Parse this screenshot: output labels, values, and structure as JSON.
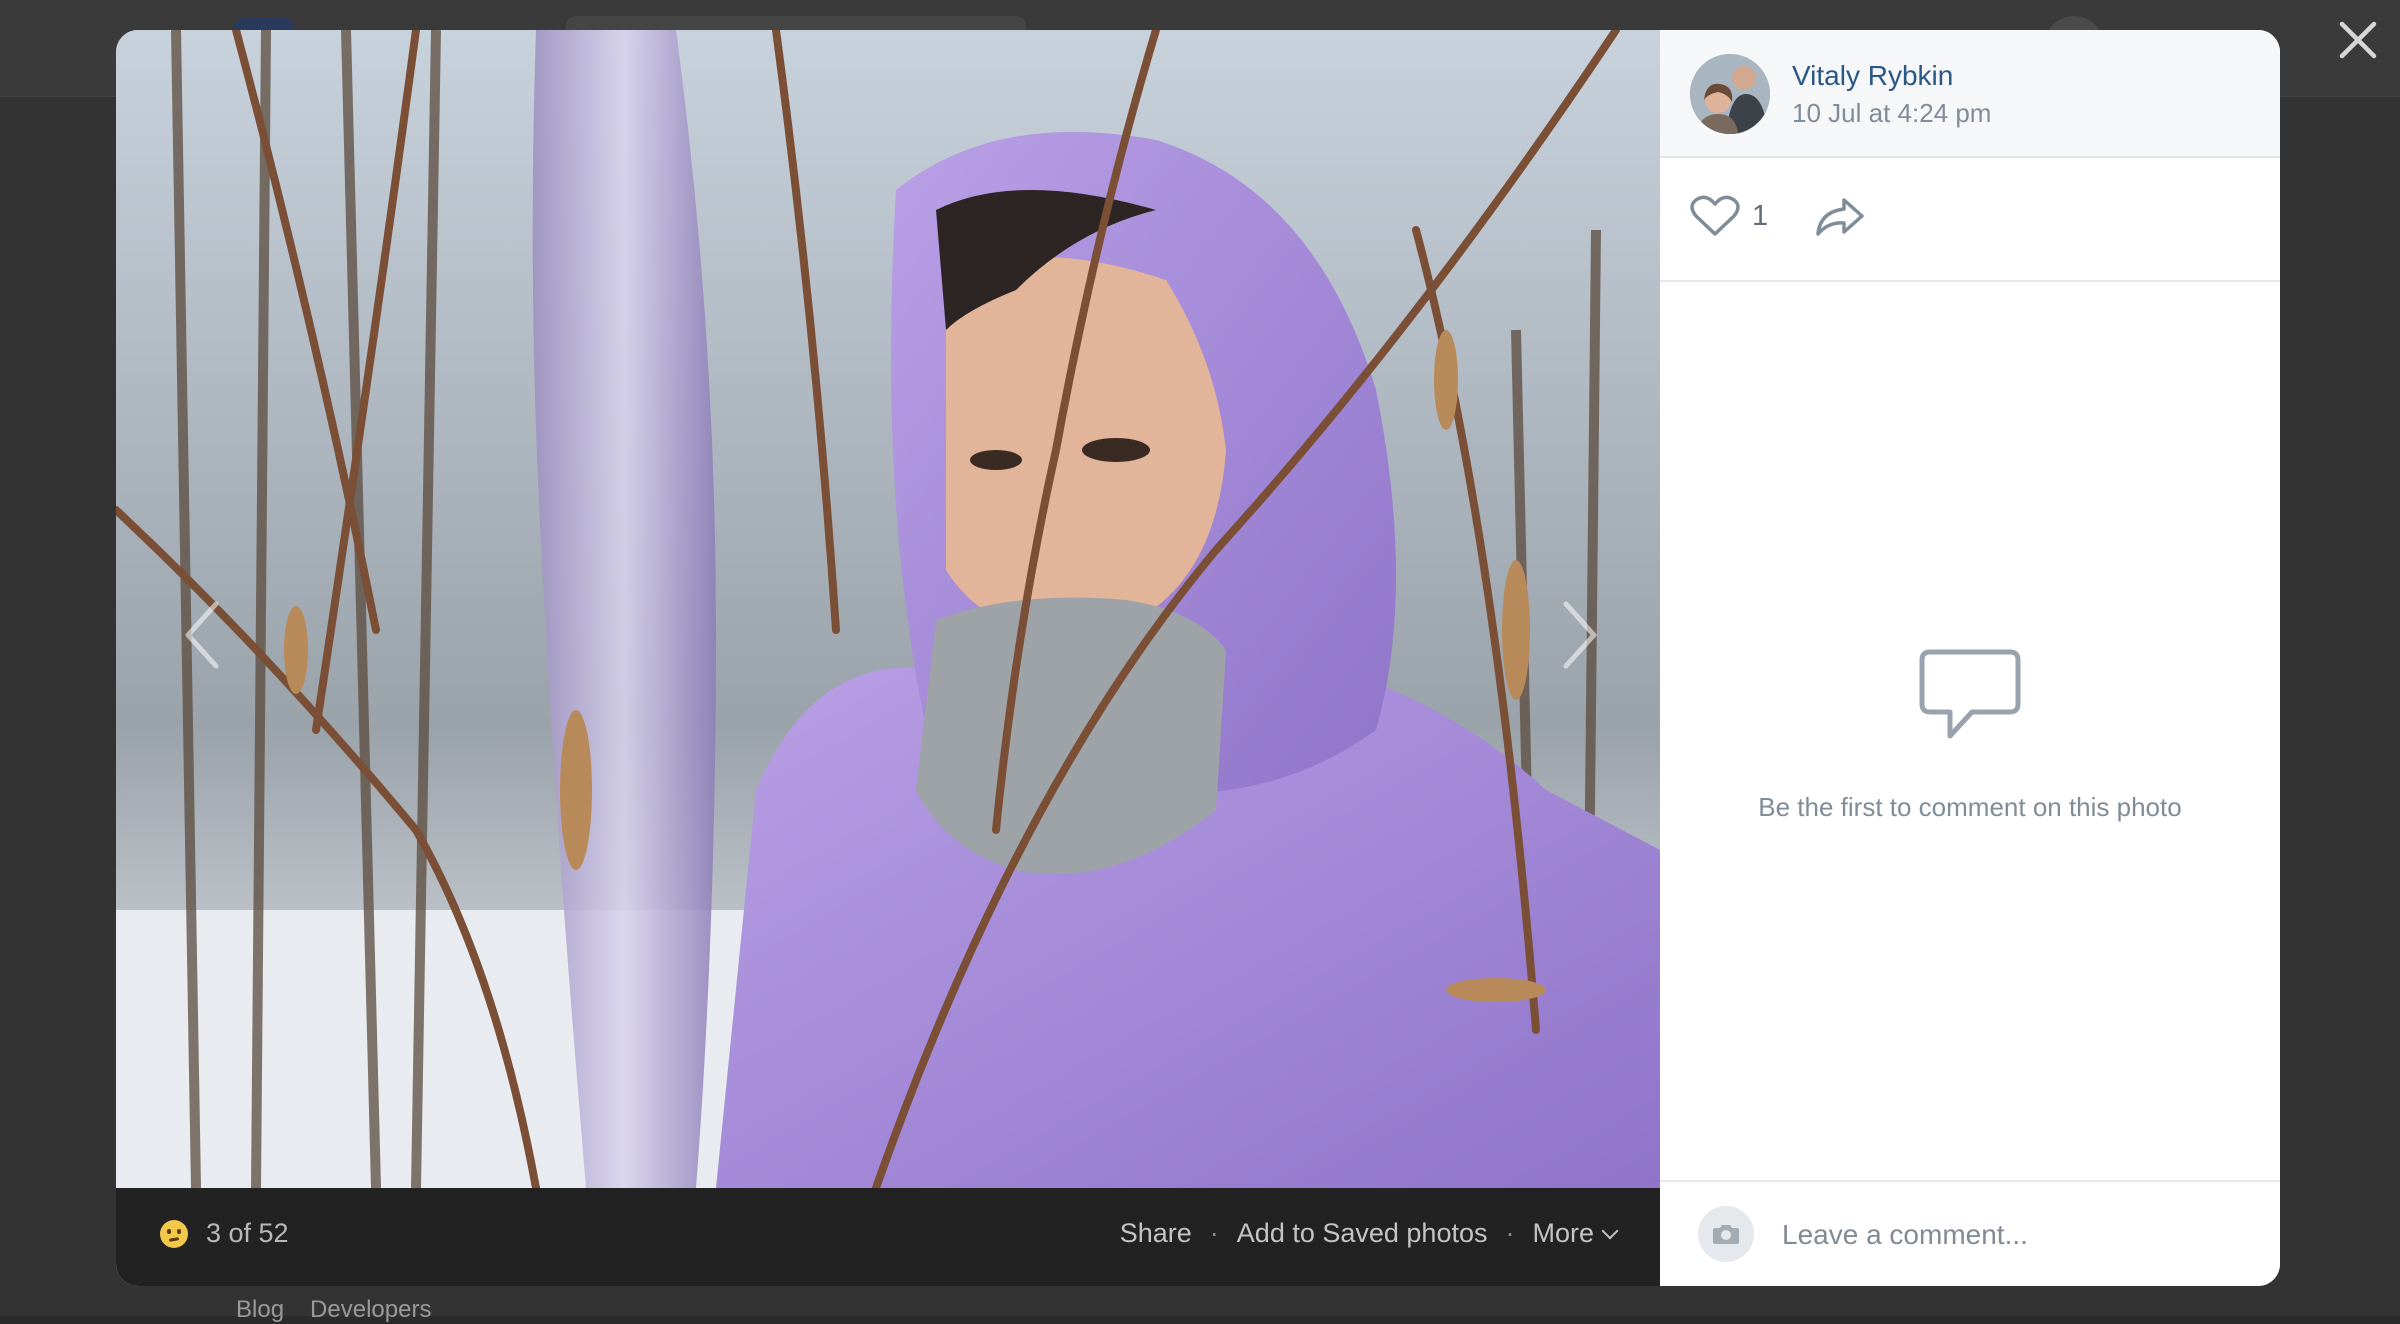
{
  "background": {
    "footer_links": [
      "Blog",
      "Developers"
    ]
  },
  "photo": {
    "counter_text": "3 of 52",
    "actions": {
      "share": "Share",
      "save": "Add to Saved photos",
      "more": "More"
    }
  },
  "post": {
    "author": "Vitaly Rybkin",
    "date": "10 Jul at 4:24 pm",
    "likes": "1"
  },
  "comments": {
    "empty_text": "Be the first to comment on this photo",
    "placeholder": "Leave a comment..."
  },
  "colors": {
    "link": "#2a5885",
    "muted": "#818c99",
    "footer_bg": "#222222"
  },
  "icons": [
    "close-icon",
    "prev-arrow-icon",
    "next-arrow-icon",
    "emoji-icon",
    "chevron-down-icon",
    "heart-icon",
    "share-arrow-icon",
    "speech-bubble-icon",
    "camera-icon"
  ]
}
